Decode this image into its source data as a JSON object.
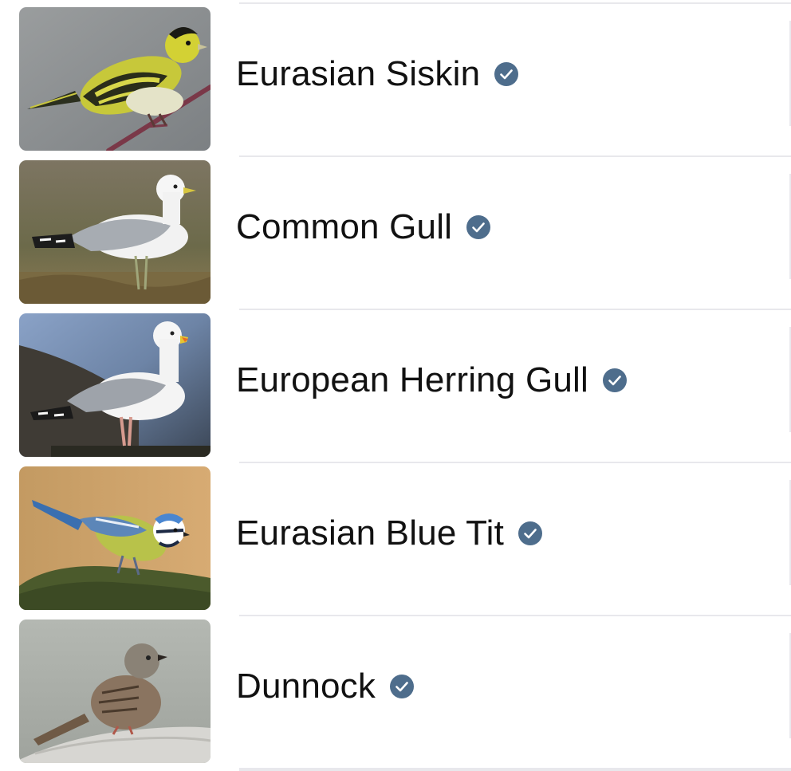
{
  "species_list": [
    {
      "name": "Eurasian Siskin",
      "verified_icon": "check-badge-icon",
      "image": "eurasian-siskin-photo"
    },
    {
      "name": "Common Gull",
      "verified_icon": "check-badge-icon",
      "image": "common-gull-photo"
    },
    {
      "name": "European Herring Gull",
      "verified_icon": "check-badge-icon",
      "image": "european-herring-gull-photo"
    },
    {
      "name": "Eurasian Blue Tit",
      "verified_icon": "check-badge-icon",
      "image": "eurasian-blue-tit-photo"
    },
    {
      "name": "Dunnock",
      "verified_icon": "check-badge-icon",
      "image": "dunnock-photo"
    }
  ],
  "colors": {
    "badge": "#4e6d8c",
    "separator": "#e8e8ec",
    "text": "#111111"
  }
}
